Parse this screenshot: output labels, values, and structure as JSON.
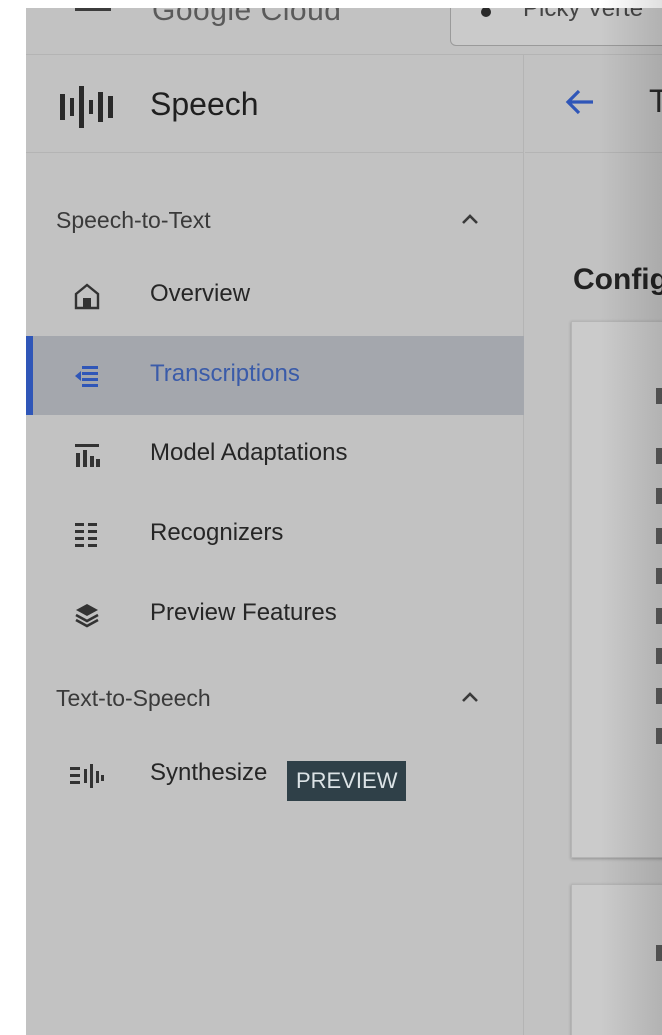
{
  "topbar": {
    "logo_text": "Google Cloud",
    "project_name": "Picky Verte"
  },
  "sidebar": {
    "product_title": "Speech",
    "sections": [
      {
        "heading": "Speech-to-Text",
        "items": [
          {
            "label": "Overview",
            "icon": "home-icon"
          },
          {
            "label": "Transcriptions",
            "icon": "transcriptions-icon",
            "active": true
          },
          {
            "label": "Model Adaptations",
            "icon": "model-adaptations-icon"
          },
          {
            "label": "Recognizers",
            "icon": "recognizers-icon"
          },
          {
            "label": "Preview Features",
            "icon": "preview-features-icon"
          }
        ]
      },
      {
        "heading": "Text-to-Speech",
        "items": [
          {
            "label": "Synthesize",
            "icon": "synthesize-icon",
            "badge": "PREVIEW"
          }
        ]
      }
    ]
  },
  "main": {
    "title_fragment": "T",
    "section_title": "Config"
  },
  "colors": {
    "accent": "#2f56b8",
    "active_bg": "#a4a7ad",
    "badge_bg": "#2f4048",
    "overlay_bg": "#c2c2c2"
  }
}
